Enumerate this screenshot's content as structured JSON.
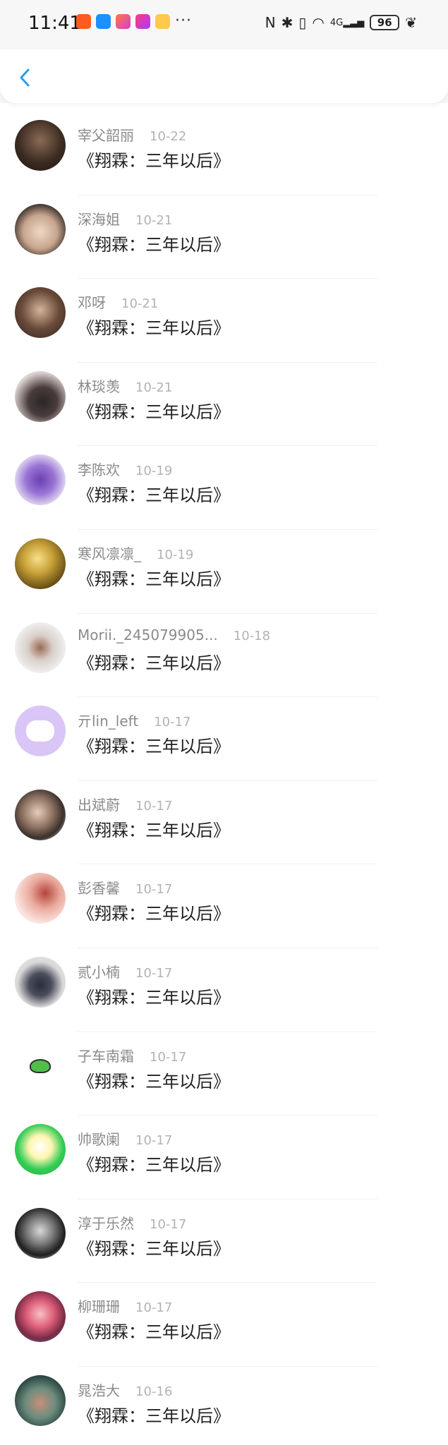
{
  "status_bar": {
    "time": "11:41",
    "more": "···",
    "network": "4G",
    "battery": "96"
  },
  "topbar": {
    "back_icon": "chevron-left-icon",
    "accent": "#2a9ee8"
  },
  "items": [
    {
      "name": "宰父韶丽",
      "date": "10-22",
      "text": "《翔霖：三年以后》"
    },
    {
      "name": "深海姐",
      "date": "10-21",
      "text": "《翔霖：三年以后》"
    },
    {
      "name": "邓呀",
      "date": "10-21",
      "text": "《翔霖：三年以后》"
    },
    {
      "name": "林琰羡",
      "date": "10-21",
      "text": "《翔霖：三年以后》"
    },
    {
      "name": "李陈欢",
      "date": "10-19",
      "text": "《翔霖：三年以后》"
    },
    {
      "name": "寒风凛凛_",
      "date": "10-19",
      "text": "《翔霖：三年以后》"
    },
    {
      "name": "Morii._245079905...",
      "date": "10-18",
      "text": "《翔霖：三年以后》"
    },
    {
      "name": "亓lin_left",
      "date": "10-17",
      "text": "《翔霖：三年以后》"
    },
    {
      "name": "出斌蔚",
      "date": "10-17",
      "text": "《翔霖：三年以后》"
    },
    {
      "name": "彭香馨",
      "date": "10-17",
      "text": "《翔霖：三年以后》"
    },
    {
      "name": "贰小楠",
      "date": "10-17",
      "text": "《翔霖：三年以后》"
    },
    {
      "name": "子车南霜",
      "date": "10-17",
      "text": "《翔霖：三年以后》"
    },
    {
      "name": "帅歌阑",
      "date": "10-17",
      "text": "《翔霖：三年以后》"
    },
    {
      "name": "淳于乐然",
      "date": "10-17",
      "text": "《翔霖：三年以后》"
    },
    {
      "name": "柳珊珊",
      "date": "10-17",
      "text": "《翔霖：三年以后》"
    },
    {
      "name": "晁浩大",
      "date": "10-16",
      "text": "《翔霖：三年以后》"
    }
  ]
}
